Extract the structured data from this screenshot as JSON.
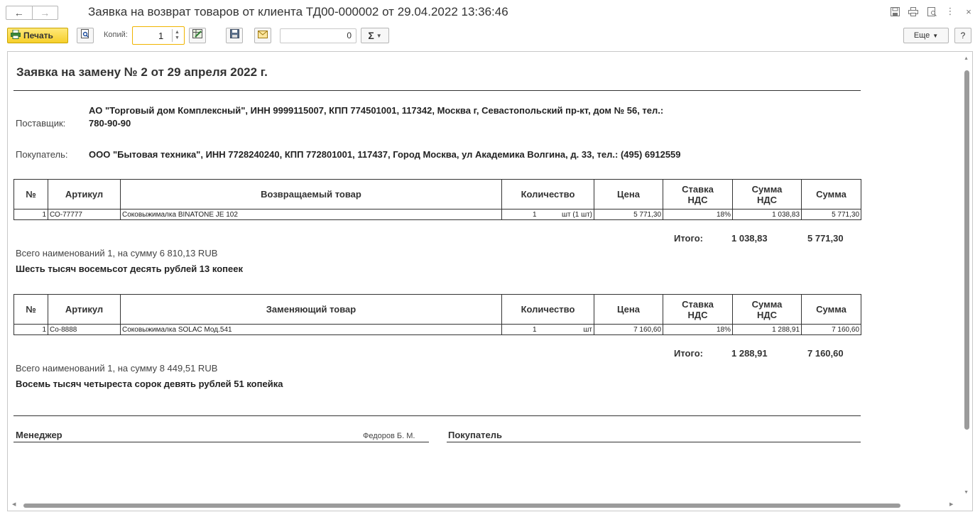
{
  "window": {
    "title": "Заявка на возврат товаров от клиента ТД00-000002 от 29.04.2022 13:36:46",
    "back_glyph": "←",
    "forward_glyph": "→",
    "more_glyph": "⋮",
    "close_glyph": "×"
  },
  "toolbar": {
    "print_label": "Печать",
    "copies_label": "Копий:",
    "copies_value": "1",
    "page_value": "0",
    "sum_label": "Σ",
    "more_label": "Еще",
    "help_label": "?"
  },
  "document": {
    "title": "Заявка на замену № 2 от 29 апреля 2022 г.",
    "supplier": {
      "label": "Поставщик:",
      "line1": "АО \"Торговый дом Комплексный\", ИНН 9999115007, КПП 774501001, 117342, Москва г, Севастопольский пр-кт, дом № 56, тел.:",
      "line2": "780-90-90"
    },
    "buyer": {
      "label": "Покупатель:",
      "text": "ООО \"Бытовая техника\", ИНН 7728240240, КПП 772801001, 117437, Город Москва, ул Академика Волгина, д. 33, тел.: (495) 6912559"
    },
    "returned": {
      "headers": {
        "num": "№",
        "article": "Артикул",
        "product": "Возвращаемый товар",
        "quantity": "Количество",
        "price": "Цена",
        "vat_rate_1": "Ставка",
        "vat_rate_2": "НДС",
        "vat_sum_1": "Сумма",
        "vat_sum_2": "НДС",
        "sum": "Сумма"
      },
      "row": {
        "num": "1",
        "article": "СО-77777",
        "product": "Соковыжималка  BINATONE JE 102",
        "qty": "1",
        "unit": "шт (1 шт)",
        "price": "5 771,30",
        "vat_rate": "18%",
        "vat_sum": "1 038,83",
        "sum": "5 771,30"
      },
      "total_label": "Итого:",
      "total_vat": "1 038,83",
      "total_sum": "5 771,30",
      "summary": "Всего наименований 1, на сумму 6 810,13 RUB",
      "words": "Шесть тысяч восемьсот десять рублей 13 копеек"
    },
    "replacement": {
      "headers": {
        "num": "№",
        "article": "Артикул",
        "product": "Заменяющий товар",
        "quantity": "Количество",
        "price": "Цена",
        "vat_rate_1": "Ставка",
        "vat_rate_2": "НДС",
        "vat_sum_1": "Сумма",
        "vat_sum_2": "НДС",
        "sum": "Сумма"
      },
      "row": {
        "num": "1",
        "article": "Со-8888",
        "product": "Соковыжималка  SOLAC  Мод.541",
        "qty": "1",
        "unit": "шт",
        "price": "7 160,60",
        "vat_rate": "18%",
        "vat_sum": "1 288,91",
        "sum": "7 160,60"
      },
      "total_label": "Итого:",
      "total_vat": "1 288,91",
      "total_sum": "7 160,60",
      "summary": "Всего наименований 1, на сумму 8 449,51 RUB",
      "words": "Восемь тысяч четыреста сорок девять рублей 51 копейка"
    },
    "signatures": {
      "manager_label": "Менеджер",
      "manager_name": "Федоров Б. М.",
      "buyer_label": "Покупатель"
    }
  },
  "colors": {
    "print_button": "#f6cf2b",
    "copies_border": "#f0b400",
    "scroll_thumb": "#9b9b9b"
  }
}
